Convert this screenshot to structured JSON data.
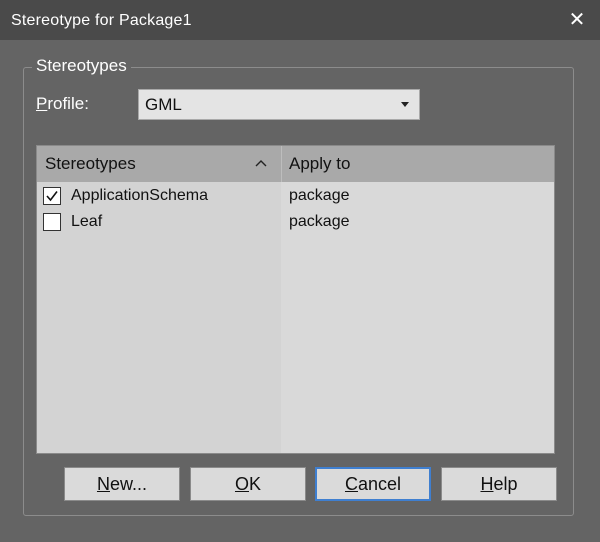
{
  "window": {
    "title": "Stereotype for Package1",
    "close_glyph": "✕"
  },
  "group": {
    "title": "Stereotypes"
  },
  "profile": {
    "label_mnemonic": "P",
    "label_rest": "rofile:",
    "value": "GML"
  },
  "list": {
    "columns": {
      "stereotypes": "Stereotypes",
      "apply_to": "Apply to"
    },
    "rows": [
      {
        "name": "ApplicationSchema",
        "apply_to": "package",
        "checked": true
      },
      {
        "name": "Leaf",
        "apply_to": "package",
        "checked": false
      }
    ]
  },
  "buttons": {
    "new": {
      "mnemonic": "N",
      "rest": "ew..."
    },
    "ok": {
      "mnemonic": "O",
      "rest": "K"
    },
    "cancel": {
      "mnemonic": "C",
      "rest": "ancel"
    },
    "help": {
      "mnemonic": "H",
      "rest": "elp"
    }
  }
}
